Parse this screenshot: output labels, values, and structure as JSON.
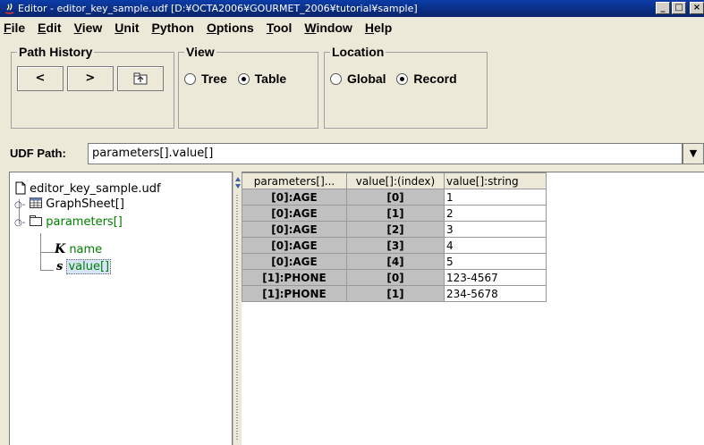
{
  "window": {
    "title": "Editor - editor_key_sample.udf [D:¥OCTA2006¥GOURMET_2006¥tutorial¥sample]",
    "minimize": "_",
    "maximize": "□",
    "close": "×"
  },
  "menu": [
    "File",
    "Edit",
    "View",
    "Unit",
    "Python",
    "Options",
    "Tool",
    "Window",
    "Help"
  ],
  "path_history": {
    "legend": "Path History",
    "back_label": "<",
    "forward_label": ">"
  },
  "view": {
    "legend": "View",
    "options": [
      {
        "label": "Tree",
        "selected": false
      },
      {
        "label": "Table",
        "selected": true
      }
    ]
  },
  "location": {
    "legend": "Location",
    "options": [
      {
        "label": "Global",
        "selected": false
      },
      {
        "label": "Record",
        "selected": true
      }
    ]
  },
  "udf_path": {
    "label": "UDF Path:",
    "value": "parameters[].value[]"
  },
  "tree": {
    "root": "editor_key_sample.udf",
    "nodes": [
      {
        "label": "GraphSheet[]",
        "icon": "table-icon"
      },
      {
        "label": "parameters[]",
        "icon": "folder-icon"
      },
      {
        "label": "name",
        "icon": "key-icon"
      },
      {
        "label": "value[]",
        "icon": "string-icon"
      }
    ]
  },
  "table": {
    "headers": [
      "parameters[]...",
      "value[]:(index)",
      "value[]:string"
    ],
    "rows": [
      [
        "[0]:AGE",
        "[0]",
        "1"
      ],
      [
        "[0]:AGE",
        "[1]",
        "2"
      ],
      [
        "[0]:AGE",
        "[2]",
        "3"
      ],
      [
        "[0]:AGE",
        "[3]",
        "4"
      ],
      [
        "[0]:AGE",
        "[4]",
        "5"
      ],
      [
        "[1]:PHONE",
        "[0]",
        "123-4567"
      ],
      [
        "[1]:PHONE",
        "[1]",
        "234-5678"
      ]
    ]
  },
  "colors": {
    "title_bar": "#0a246a",
    "window_bg": "#ece9d8",
    "key_cell_bg": "#c0c0c0",
    "tree_highlight": "#008000"
  }
}
